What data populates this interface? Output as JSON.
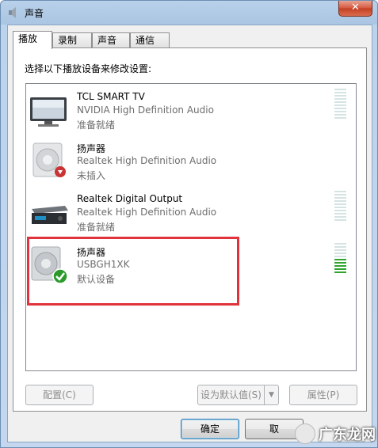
{
  "window": {
    "title": "声音",
    "close_glyph": "✕"
  },
  "tabs": [
    {
      "label": "播放",
      "active": true
    },
    {
      "label": "录制",
      "active": false
    },
    {
      "label": "声音",
      "active": false
    },
    {
      "label": "通信",
      "active": false
    }
  ],
  "instruction": "选择以下播放设备来修改设置:",
  "devices": [
    {
      "name": "TCL SMART TV",
      "driver": "NVIDIA High Definition Audio",
      "status": "准备就绪",
      "icon": "tv-icon",
      "level": 0
    },
    {
      "name": "扬声器",
      "driver": "Realtek High Definition Audio",
      "status": "未插入",
      "icon": "speaker-unplugged-icon",
      "level": null
    },
    {
      "name": "Realtek Digital Output",
      "driver": "Realtek High Definition Audio",
      "status": "准备就绪",
      "icon": "digital-output-icon",
      "level": 0
    },
    {
      "name": "扬声器",
      "driver": "USBGH1XK",
      "status": "默认设备",
      "icon": "speaker-default-icon",
      "level": 0.45
    }
  ],
  "buttons": {
    "configure": "配置(C)",
    "set_default": "设为默认值(S)",
    "properties": "属性(P)",
    "ok": "确定",
    "cancel": "取"
  },
  "watermark": {
    "text": "广东龙网"
  },
  "colors": {
    "highlight": "#e0333b",
    "meter_on": "#2fa52f",
    "meter_off": "#d5e3e3"
  }
}
